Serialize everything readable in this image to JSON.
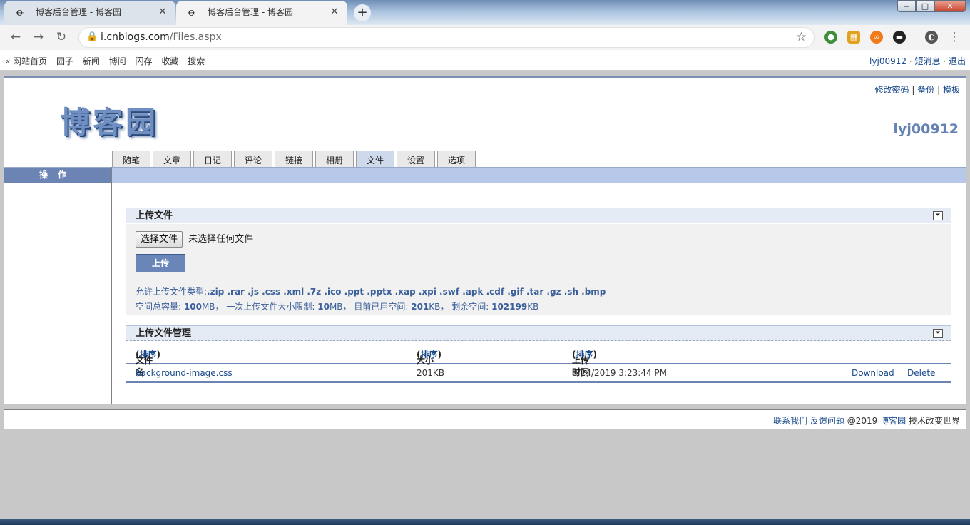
{
  "browser": {
    "tabs": [
      {
        "title": "博客后台管理 - 博客园",
        "favicon": "cnblogs-icon",
        "active": false
      },
      {
        "title": "博客后台管理 - 博客园",
        "favicon": "cnblogs-icon",
        "active": true
      }
    ],
    "new_tab": "+",
    "window_buttons": {
      "minimize": "‒",
      "maximize": "□",
      "close": "✕"
    },
    "back": "←",
    "forward": "→",
    "reload": "↻",
    "address": {
      "host": "i.cnblogs.com",
      "path": "/Files.aspx"
    },
    "menu": "⋮"
  },
  "sitebar": {
    "prefix": "«",
    "links": [
      "网站首页",
      "园子",
      "新闻",
      "博问",
      "闪存",
      "收藏",
      "搜索"
    ],
    "user": "lyj00912",
    "sep": "·",
    "messages": "短消息",
    "logout": "退出"
  },
  "header": {
    "links": [
      "修改密码",
      "备份",
      "模板"
    ],
    "link_sep": "|",
    "logo": "博客园",
    "username": "lyj00912"
  },
  "nav_tabs": [
    {
      "label": "随笔",
      "active": false
    },
    {
      "label": "文章",
      "active": false
    },
    {
      "label": "日记",
      "active": false
    },
    {
      "label": "评论",
      "active": false
    },
    {
      "label": "链接",
      "active": false
    },
    {
      "label": "相册",
      "active": false
    },
    {
      "label": "文件",
      "active": true
    },
    {
      "label": "设置",
      "active": false
    },
    {
      "label": "选项",
      "active": false
    }
  ],
  "sidebar": {
    "title": "操作"
  },
  "upload": {
    "title": "上传文件",
    "collapse": "⏷",
    "choose_button": "选择文件",
    "no_file_text": "未选择任何文件",
    "upload_button": "上传",
    "allowed_label": "允许上传文件类型:",
    "allowed_types": ".zip .rar .js .css .xml .7z .ico .ppt .pptx .xap .xpi .swf .apk .cdf .gif .tar .gz .sh .bmp",
    "quota": {
      "total_label": "空间总容量:",
      "total_value": "100",
      "total_unit": "MB，",
      "single_label": "一次上传文件大小限制:",
      "single_value": "10",
      "single_unit": "MB，",
      "used_label": "目前已用空间:",
      "used_value": "201",
      "used_unit": "KB，",
      "free_label": "剩余空间:",
      "free_value": "102199",
      "free_unit": "KB"
    }
  },
  "files": {
    "title": "上传文件管理",
    "columns": {
      "name": "文件名",
      "size": "大小",
      "time": "上传时间",
      "sort": "排序"
    },
    "rows": [
      {
        "name": "background-image.css",
        "size": "201KB",
        "time": "8/24/2019 3:23:44 PM",
        "download": "Download",
        "delete": "Delete"
      }
    ]
  },
  "footer": {
    "links": [
      "联系我们",
      "反馈问题"
    ],
    "copyright": "@2019",
    "site": "博客园",
    "slogan": "技术改变世界"
  }
}
